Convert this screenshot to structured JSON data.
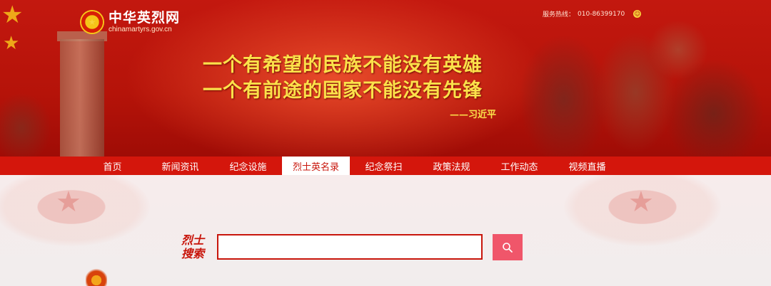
{
  "header": {
    "logo_title": "中华英烈网",
    "logo_domain": "chinamartyrs.gov.cn",
    "hotline_label": "服务热线：",
    "hotline_number": "010-86399170",
    "slogan_line1": "一个有希望的民族不能没有英雄",
    "slogan_line2": "一个有前途的国家不能没有先锋",
    "slogan_signature": "——习近平"
  },
  "nav": {
    "items": [
      {
        "label": "首页"
      },
      {
        "label": "新闻资讯"
      },
      {
        "label": "纪念设施"
      },
      {
        "label": "烈士英名录",
        "active": true
      },
      {
        "label": "纪念祭扫"
      },
      {
        "label": "政策法规"
      },
      {
        "label": "工作动态"
      },
      {
        "label": "视频直播"
      }
    ]
  },
  "search": {
    "label_line1": "烈士",
    "label_line2": "搜索",
    "value": "",
    "button_icon": "search-icon"
  },
  "colors": {
    "brand_red": "#d4160c",
    "slogan_yellow": "#fbe14a",
    "search_button": "#f0566a"
  }
}
